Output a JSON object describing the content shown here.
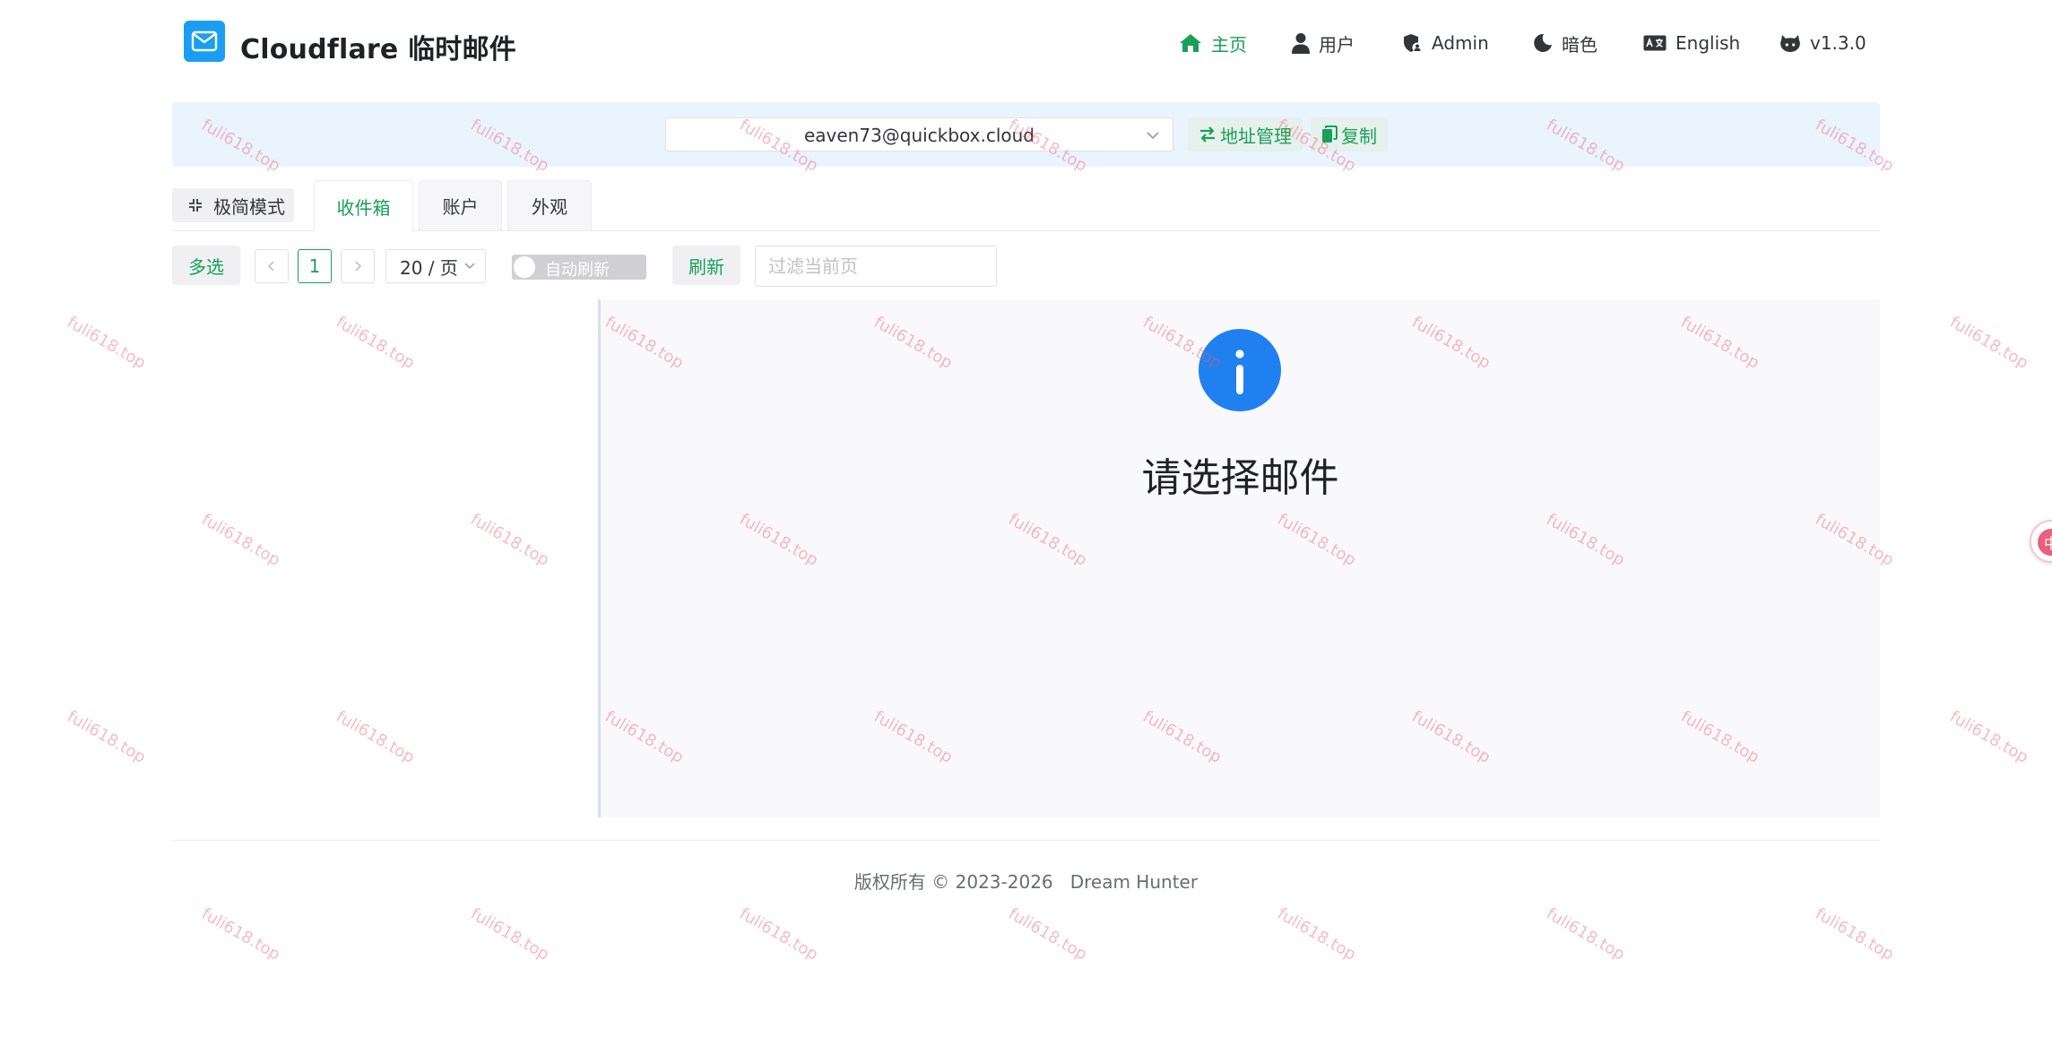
{
  "app": {
    "title": "Cloudflare 临时邮件",
    "logo_icon": "mail-icon",
    "brand_color": "#1a9ef3"
  },
  "nav": [
    {
      "label": "主页",
      "icon": "home-icon",
      "active": true
    },
    {
      "label": "用户",
      "icon": "user-icon"
    },
    {
      "label": "Admin",
      "icon": "shield-user-icon"
    },
    {
      "label": "暗色",
      "icon": "moon-icon"
    },
    {
      "label": "English",
      "icon": "language-icon"
    },
    {
      "label": "v1.3.0",
      "icon": "github-icon"
    }
  ],
  "address_bar": {
    "selected_address": "eaven73@quickbox.cloud",
    "manage_label": "地址管理",
    "copy_label": "复制"
  },
  "tabs": {
    "mini_mode_label": "极简模式",
    "items": [
      {
        "label": "收件箱",
        "active": true
      },
      {
        "label": "账户"
      },
      {
        "label": "外观"
      }
    ]
  },
  "toolbar": {
    "multi_select_label": "多选",
    "current_page": "1",
    "page_size_label": "20 / 页",
    "auto_refresh_label": "自动刷新",
    "auto_refresh_on": false,
    "refresh_label": "刷新",
    "filter_placeholder": "过滤当前页"
  },
  "detail": {
    "empty_icon": "info-icon",
    "empty_title": "请选择邮件"
  },
  "footer": {
    "text": "版权所有 © 2023-2026   Dream Hunter"
  },
  "watermark": {
    "text": "fuli618.top"
  },
  "side_widget": {
    "label": "中"
  },
  "colors": {
    "accent": "#18a058",
    "info": "#2080f0",
    "address_bar_bg": "#eaf4ff",
    "watermark": "#ec5c6e"
  }
}
